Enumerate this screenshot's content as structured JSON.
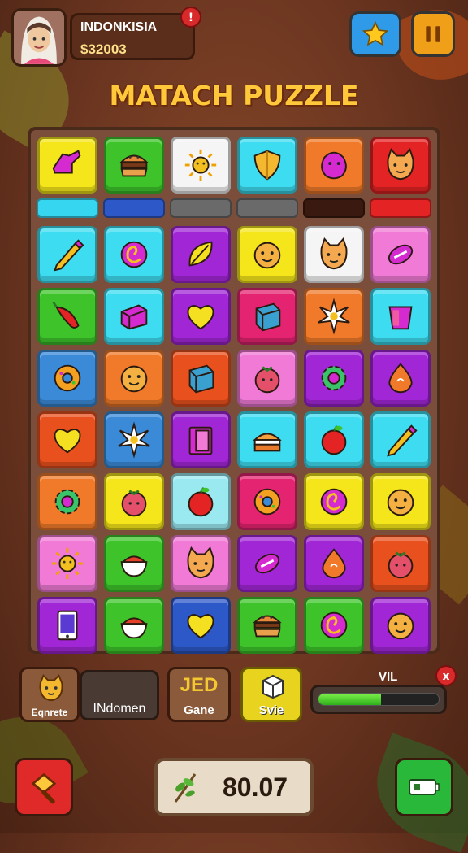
{
  "header": {
    "player_name": "INDONKISIA",
    "coins": "$32003",
    "notification": "!",
    "star_button": "star-icon",
    "pause_button": "pause-icon"
  },
  "title": "MATACH PUZZLE",
  "board": {
    "top_row": [
      {
        "color": "#f4e61a",
        "icon": "shoe"
      },
      {
        "color": "#3ec42a",
        "icon": "burger"
      },
      {
        "color": "#f5f5f5",
        "icon": "sun"
      },
      {
        "color": "#3edcf0",
        "icon": "shield"
      },
      {
        "color": "#f07a2a",
        "icon": "blob"
      },
      {
        "color": "#e42424",
        "icon": "cat"
      }
    ],
    "indicator_bars": [
      "#36d6f0",
      "#2c58c8",
      "#6a6a6a",
      "#6a6a6a",
      "#3a1a10",
      "#e42424"
    ],
    "rows": [
      [
        {
          "color": "#3edcf0",
          "icon": "pencil"
        },
        {
          "color": "#3edcf0",
          "icon": "swirl"
        },
        {
          "color": "#a126d6",
          "icon": "leaf"
        },
        {
          "color": "#f4e61a",
          "icon": "face"
        },
        {
          "color": "#f5f5f5",
          "icon": "cat"
        },
        {
          "color": "#f07ad6",
          "icon": "candy"
        }
      ],
      [
        {
          "color": "#3ec42a",
          "icon": "pepper"
        },
        {
          "color": "#3edcf0",
          "icon": "box"
        },
        {
          "color": "#a126d6",
          "icon": "heart"
        },
        {
          "color": "#e42470",
          "icon": "cube"
        },
        {
          "color": "#f07a2a",
          "icon": "burst"
        },
        {
          "color": "#3edcf0",
          "icon": "cup"
        }
      ],
      [
        {
          "color": "#3a8ad8",
          "icon": "donut"
        },
        {
          "color": "#f07a2a",
          "icon": "face"
        },
        {
          "color": "#e8501e",
          "icon": "cube"
        },
        {
          "color": "#f07ad6",
          "icon": "berry"
        },
        {
          "color": "#a126d6",
          "icon": "gear"
        },
        {
          "color": "#a126d6",
          "icon": "drop"
        }
      ],
      [
        {
          "color": "#e8501e",
          "icon": "heart"
        },
        {
          "color": "#3a8ad8",
          "icon": "burst"
        },
        {
          "color": "#a126d6",
          "icon": "door"
        },
        {
          "color": "#3edcf0",
          "icon": "cake"
        },
        {
          "color": "#3edcf0",
          "icon": "apple"
        },
        {
          "color": "#3edcf0",
          "icon": "pencil"
        }
      ],
      [
        {
          "color": "#f07a2a",
          "icon": "gear"
        },
        {
          "color": "#f4e61a",
          "icon": "berry"
        },
        {
          "color": "#9ae8f0",
          "icon": "apple"
        },
        {
          "color": "#e42470",
          "icon": "donut"
        },
        {
          "color": "#f4e61a",
          "icon": "swirl"
        },
        {
          "color": "#f4e61a",
          "icon": "face"
        }
      ],
      [
        {
          "color": "#f07ad6",
          "icon": "sun"
        },
        {
          "color": "#3ec42a",
          "icon": "bowl"
        },
        {
          "color": "#f07ad6",
          "icon": "cat"
        },
        {
          "color": "#a126d6",
          "icon": "candy"
        },
        {
          "color": "#a126d6",
          "icon": "drop"
        },
        {
          "color": "#e8501e",
          "icon": "berry"
        }
      ],
      [
        {
          "color": "#a126d6",
          "icon": "phone"
        },
        {
          "color": "#3ec42a",
          "icon": "bowl"
        },
        {
          "color": "#2c58c8",
          "icon": "heart"
        },
        {
          "color": "#3ec42a",
          "icon": "burger"
        },
        {
          "color": "#3ec42a",
          "icon": "swirl"
        },
        {
          "color": "#a126d6",
          "icon": "face"
        }
      ]
    ]
  },
  "panel": {
    "character_label": "Eqnrete",
    "name_field": "INdomen",
    "game_button_top": "JED",
    "game_button_label": "Gane",
    "save_button_label": "Svie",
    "progress_label": "VIL",
    "progress_close": "x",
    "progress_fraction": 0.52
  },
  "footer": {
    "left_button": "hammer-icon",
    "score": "80.07",
    "right_button": "battery-icon"
  }
}
